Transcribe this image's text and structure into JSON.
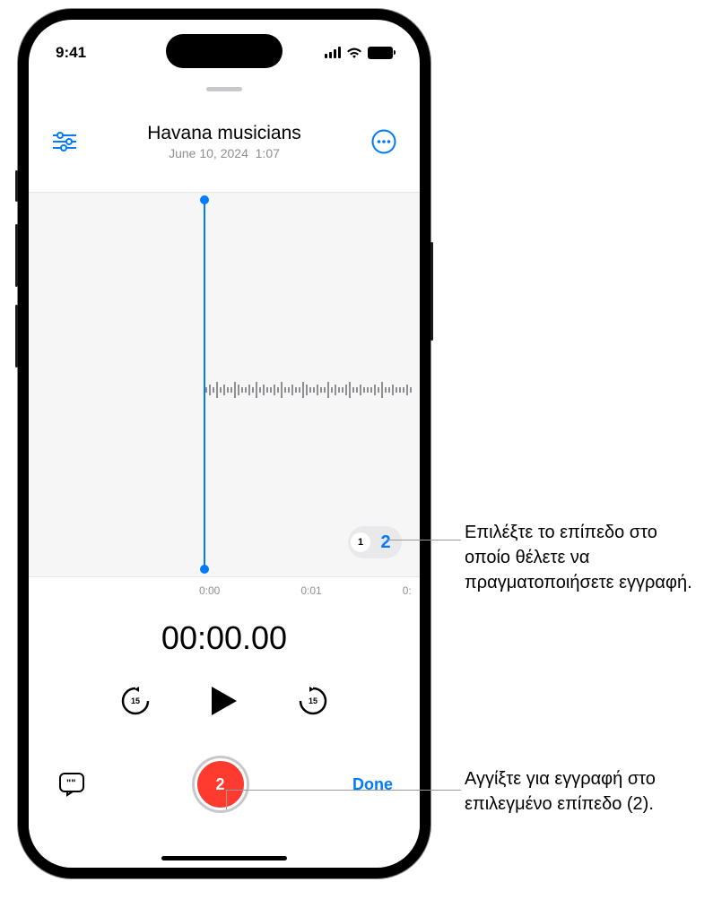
{
  "status": {
    "time": "9:41"
  },
  "header": {
    "title": "Havana musicians",
    "date": "June 10, 2024",
    "duration": "1:07"
  },
  "layers": {
    "layer1": "1",
    "layer2": "2"
  },
  "ruler": {
    "t0": "0:00",
    "t1": "0:01",
    "t2": "0:"
  },
  "timer": "00:00.00",
  "controls": {
    "skip_back": "15",
    "skip_fwd": "15"
  },
  "record": {
    "layer_num": "2"
  },
  "done_label": "Done",
  "callouts": {
    "c1": "Επιλέξτε το επίπεδο στο οποίο θέλετε να πραγματοποιήσετε εγγραφή.",
    "c2": "Αγγίξτε για εγγραφή στο επιλεγμένο επίπεδο (2)."
  }
}
